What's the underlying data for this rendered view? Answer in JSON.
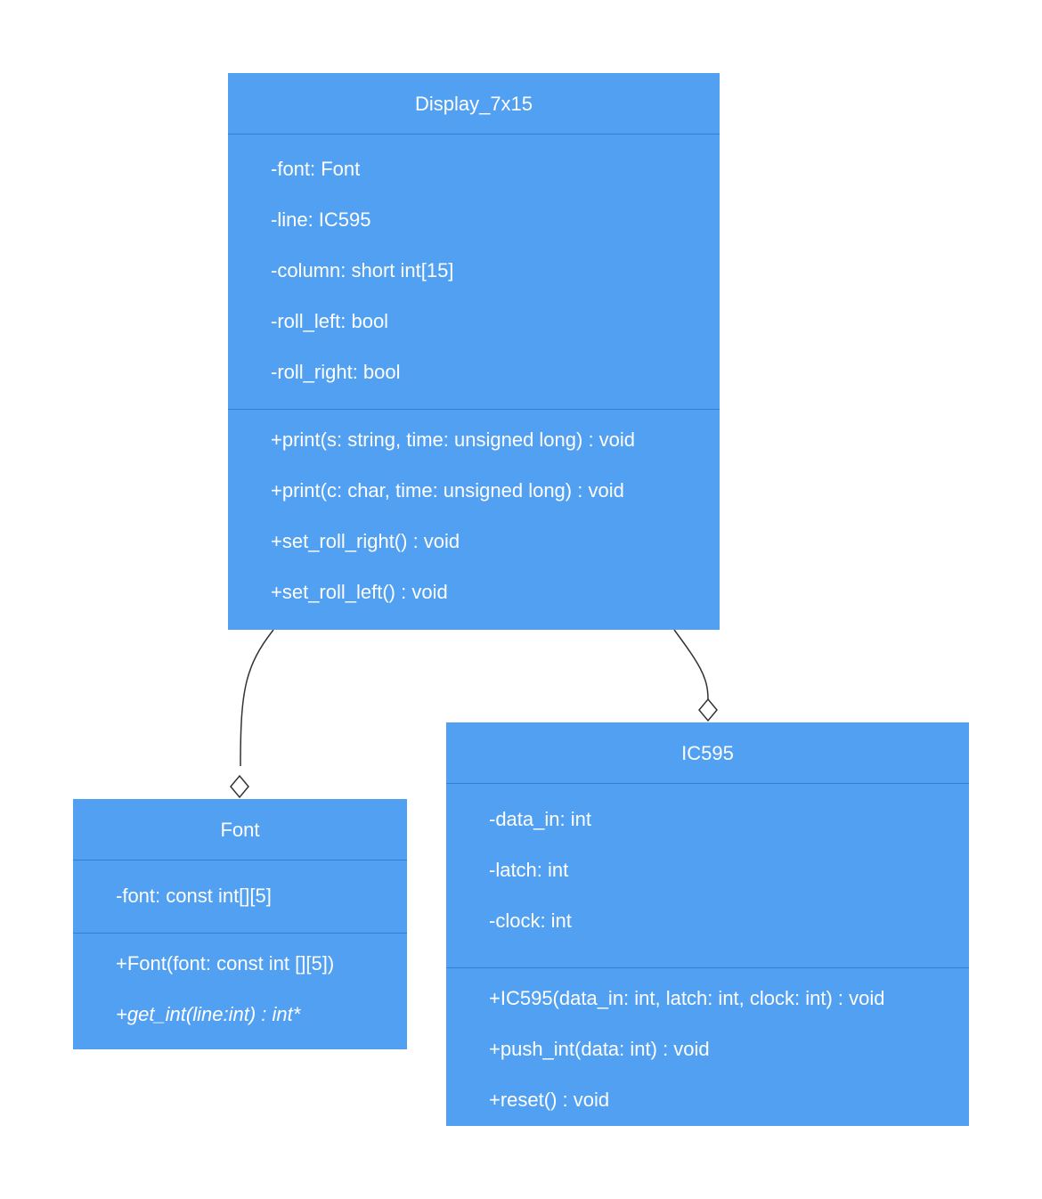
{
  "classes": {
    "display": {
      "name": "Display_7x15",
      "attributes": [
        "-font: Font",
        "-line: IC595",
        "-column: short int[15]",
        "-roll_left: bool",
        "-roll_right: bool"
      ],
      "methods": [
        "+print(s: string, time: unsigned long) : void",
        "+print(c: char, time: unsigned long) : void",
        "+set_roll_right() : void",
        "+set_roll_left() : void"
      ]
    },
    "font": {
      "name": "Font",
      "attributes": [
        "-font: const int[][5]"
      ],
      "methods": [
        "+Font(font: const int [][5])",
        "+get_int(line:int) : int*"
      ]
    },
    "ic595": {
      "name": "IC595",
      "attributes": [
        "-data_in: int",
        "-latch: int",
        "-clock: int"
      ],
      "methods": [
        "+IC595(data_in: int, latch: int, clock: int) : void",
        "+push_int(data: int) : void",
        "+reset() : void"
      ]
    }
  },
  "relationships": [
    {
      "type": "aggregation",
      "from": "Display_7x15",
      "to": "Font"
    },
    {
      "type": "aggregation",
      "from": "Display_7x15",
      "to": "IC595"
    }
  ],
  "colors": {
    "class_fill": "#52a0f2",
    "divider": "#2f7fd6",
    "text": "#ffffff",
    "connector": "#333333"
  }
}
